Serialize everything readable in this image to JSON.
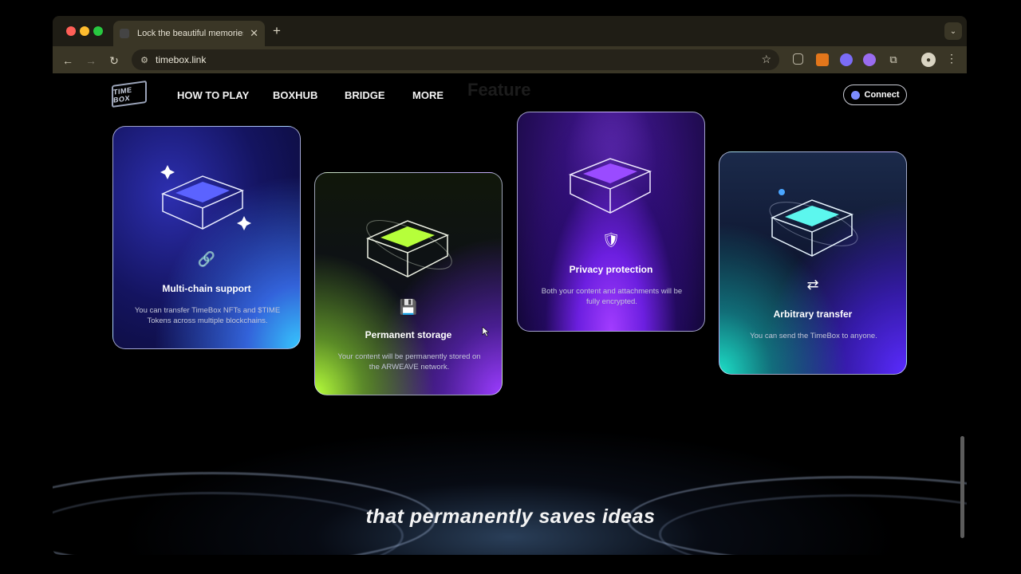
{
  "browser": {
    "tab_title": "Lock the beautiful memories",
    "tab_close": "✕",
    "new_tab": "+",
    "url": "timebox.link"
  },
  "site": {
    "logo_text": "TIME BOX",
    "faded_heading": "Feature",
    "nav": [
      "HOW TO PLAY",
      "BOXHUB",
      "BRIDGE",
      "MORE"
    ],
    "connect_label": "Connect"
  },
  "cards": [
    {
      "title": "Multi-chain support",
      "desc": "You can transfer TimeBox NFTs and $TIME Tokens across multiple blockchains.",
      "icon": "link-icon",
      "glyph": "🔗",
      "accent": "#5b63ff"
    },
    {
      "title": "Permanent storage",
      "desc": "Your content will be permanently stored on the ARWEAVE network.",
      "icon": "floppy-disk-icon",
      "glyph": "💾",
      "accent": "#b6ff3a"
    },
    {
      "title": "Privacy protection",
      "desc": "Both your content and attachments will be fully encrypted.",
      "icon": "shield-check-icon",
      "glyph": "🛡",
      "accent": "#9a4bff"
    },
    {
      "title": "Arbitrary transfer",
      "desc": "You can send the TimeBox to anyone.",
      "icon": "transfer-icon",
      "glyph": "⇄",
      "accent": "#5cf7ee"
    }
  ],
  "caption": "that permanently saves ideas"
}
